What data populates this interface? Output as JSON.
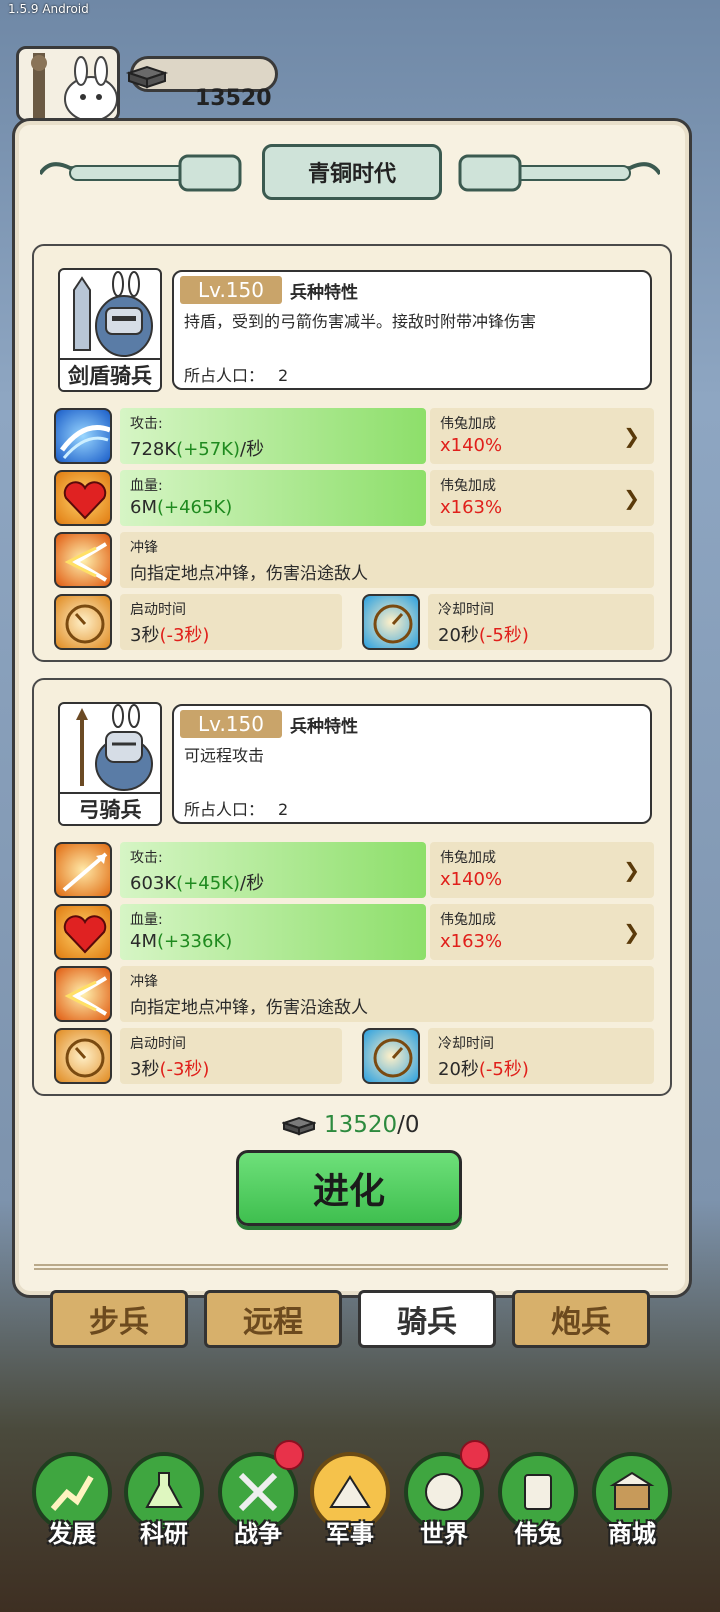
{
  "version": "1.5.9 Android",
  "resource": {
    "amount": "13520"
  },
  "era_title": "青铜时代",
  "units": [
    {
      "name": "剑盾骑兵",
      "level": "Lv.150",
      "trait_title": "兵种特性",
      "trait_desc": "持盾，受到的弓箭伤害减半。接敌时附带冲锋伤害",
      "pop_label": "所占人口：",
      "pop_value": "2",
      "attack": {
        "label": "攻击:",
        "base": "728K",
        "bonus": "(+57K)",
        "suffix": "/秒",
        "rabbit_label": "伟兔加成",
        "rabbit_value": "x140%"
      },
      "hp": {
        "label": "血量:",
        "base": "6M",
        "bonus": "(+465K)",
        "rabbit_label": "伟兔加成",
        "rabbit_value": "x163%"
      },
      "skill": {
        "label": "冲锋",
        "desc": "向指定地点冲锋，伤害沿途敌人"
      },
      "start": {
        "label": "启动时间",
        "base": "3秒",
        "bonus": "(-3秒)"
      },
      "cooldown": {
        "label": "冷却时间",
        "base": "20秒",
        "bonus": "(-5秒)"
      }
    },
    {
      "name": "弓骑兵",
      "level": "Lv.150",
      "trait_title": "兵种特性",
      "trait_desc": "可远程攻击",
      "pop_label": "所占人口：",
      "pop_value": "2",
      "attack": {
        "label": "攻击:",
        "base": "603K",
        "bonus": "(+45K)",
        "suffix": "/秒",
        "rabbit_label": "伟兔加成",
        "rabbit_value": "x140%"
      },
      "hp": {
        "label": "血量:",
        "base": "4M",
        "bonus": "(+336K)",
        "rabbit_label": "伟兔加成",
        "rabbit_value": "x163%"
      },
      "skill": {
        "label": "冲锋",
        "desc": "向指定地点冲锋，伤害沿途敌人"
      },
      "start": {
        "label": "启动时间",
        "base": "3秒",
        "bonus": "(-3秒)"
      },
      "cooldown": {
        "label": "冷却时间",
        "base": "20秒",
        "bonus": "(-5秒)"
      }
    }
  ],
  "cost": {
    "have": "13520",
    "need": "/0"
  },
  "evolve_label": "进化",
  "tabs": [
    "步兵",
    "远程",
    "骑兵",
    "炮兵"
  ],
  "active_tab": "骑兵",
  "nav": [
    "发展",
    "科研",
    "战争",
    "军事",
    "世界",
    "伟兔",
    "商城"
  ],
  "active_nav": "军事"
}
